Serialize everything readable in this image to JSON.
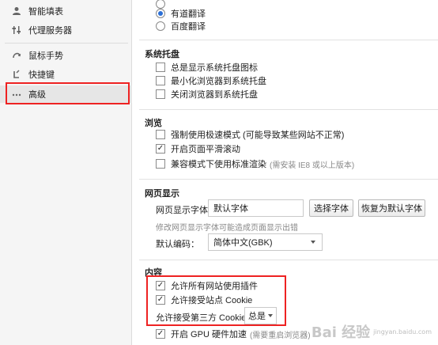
{
  "sidebar": {
    "items": [
      {
        "label": "智能填表",
        "icon": "person-icon"
      },
      {
        "label": "代理服务器",
        "icon": "sliders-icon"
      },
      {
        "label": "鼠标手势",
        "icon": "gesture-icon"
      },
      {
        "label": "快捷键",
        "icon": "shortcut-icon"
      },
      {
        "label": "高级",
        "icon": "more-dots-icon"
      }
    ]
  },
  "translate": {
    "options": [
      {
        "label": "有道翻译",
        "selected": true
      },
      {
        "label": "百度翻译",
        "selected": false
      }
    ]
  },
  "tray": {
    "title": "系统托盘",
    "options": [
      {
        "label": "总是显示系统托盘图标",
        "checked": false
      },
      {
        "label": "最小化浏览器到系统托盘",
        "checked": false
      },
      {
        "label": "关闭浏览器到系统托盘",
        "checked": false
      }
    ]
  },
  "browse": {
    "title": "浏览",
    "options": [
      {
        "label": "强制使用极速模式 (可能导致某些网站不正常)",
        "checked": false
      },
      {
        "label": "开启页面平滑滚动",
        "checked": true
      },
      {
        "label": "兼容模式下使用标准渲染",
        "note": "(需安装 IE8 或以上版本)",
        "checked": false
      }
    ]
  },
  "webfont": {
    "title": "网页显示",
    "font_label": "网页显示字体：",
    "font_value": "默认字体",
    "choose_button": "选择字体",
    "reset_button": "恢复为默认字体",
    "hint": "修改网页显示字体可能造成页面显示出错",
    "encoding_label": "默认编码：",
    "encoding_value": "简体中文(GBK)"
  },
  "content": {
    "title": "内容",
    "options": [
      {
        "label": "允许所有网站使用插件",
        "checked": true
      },
      {
        "label": "允许接受站点 Cookie",
        "checked": true
      }
    ],
    "third_party_label": "允许接受第三方 Cookie：",
    "third_party_value": "总是",
    "gpu_label": "开启 GPU 硬件加速",
    "gpu_note": "(需要重启浏览器)",
    "gpu_checked": true
  },
  "watermark": {
    "text": "Bai 经验",
    "sub": "jingyan.baidu.com"
  },
  "colors": {
    "highlight": "#e22222",
    "radio_accent": "#2b6fd6"
  }
}
